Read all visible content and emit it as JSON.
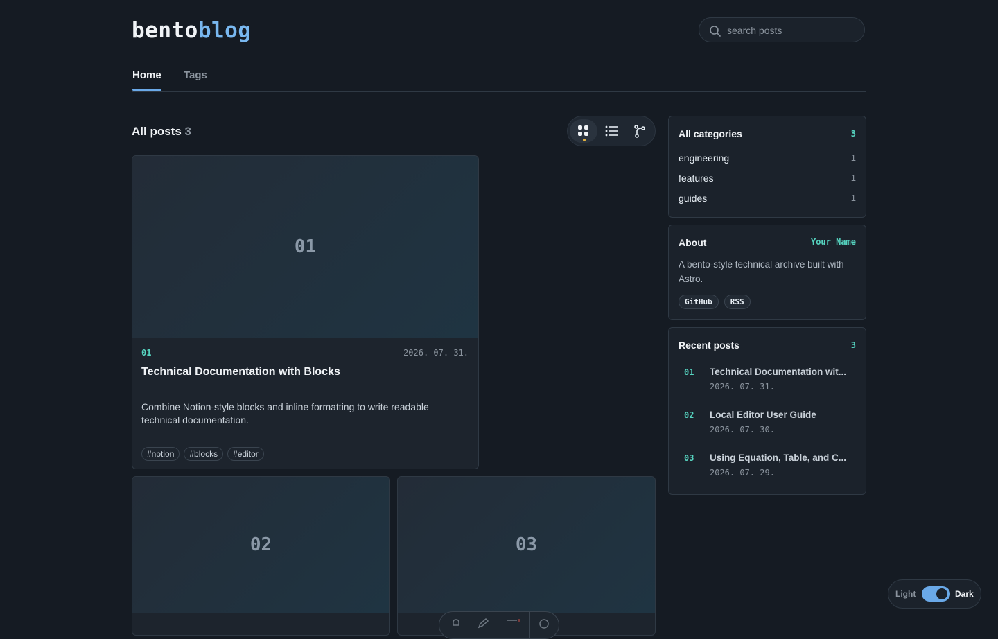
{
  "logo": {
    "part1": "bento",
    "part2": "blog"
  },
  "search": {
    "placeholder": "search posts",
    "value": ""
  },
  "tabs": [
    {
      "label": "Home",
      "active": true
    },
    {
      "label": "Tags",
      "active": false
    }
  ],
  "posts_header": {
    "title": "All posts",
    "count": "3"
  },
  "view_modes": [
    {
      "name": "grid",
      "icon": "grid-icon",
      "active": true
    },
    {
      "name": "list",
      "icon": "list-icon",
      "active": false
    },
    {
      "name": "graph",
      "icon": "graph-icon",
      "active": false
    }
  ],
  "posts": [
    {
      "num": "01",
      "date": "2026. 07. 31.",
      "title": "Technical Documentation with Blocks",
      "description": "Combine Notion-style blocks and inline formatting to write readable technical documentation.",
      "tags": [
        "#notion",
        "#blocks",
        "#editor"
      ]
    },
    {
      "num": "02"
    },
    {
      "num": "03"
    }
  ],
  "categories": {
    "title": "All categories",
    "count": "3",
    "items": [
      {
        "name": "engineering",
        "count": "1"
      },
      {
        "name": "features",
        "count": "1"
      },
      {
        "name": "guides",
        "count": "1"
      }
    ]
  },
  "about": {
    "title": "About",
    "author": "Your Name",
    "text": "A bento-style technical archive built with Astro.",
    "links": [
      "GitHub",
      "RSS"
    ]
  },
  "recent": {
    "title": "Recent posts",
    "count": "3",
    "items": [
      {
        "num": "01",
        "title": "Technical Documentation wit...",
        "date": "2026. 07. 31."
      },
      {
        "num": "02",
        "title": "Local Editor User Guide",
        "date": "2026. 07. 30."
      },
      {
        "num": "03",
        "title": "Using Equation, Table, and C...",
        "date": "2026. 07. 29."
      }
    ]
  },
  "theme_toggle": {
    "light_label": "Light",
    "dark_label": "Dark",
    "mode": "dark"
  },
  "colors": {
    "accent": "#6aa9e8",
    "teal": "#56d4c0",
    "background": "#151b23"
  }
}
